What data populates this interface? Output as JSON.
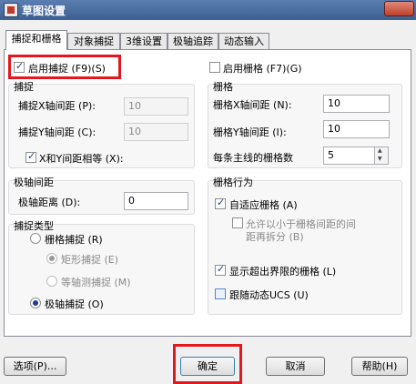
{
  "window": {
    "title": "草图设置"
  },
  "tabs": [
    {
      "label": "捕捉和栅格"
    },
    {
      "label": "对象捕捉"
    },
    {
      "label": "3维设置"
    },
    {
      "label": "极轴追踪"
    },
    {
      "label": "动态输入"
    }
  ],
  "snap": {
    "enable_label": "启用捕捉 (F9)(S)",
    "enabled": true,
    "group_title": "捕捉",
    "x_spacing_label": "捕捉X轴间距 (P):",
    "x_spacing_value": "10",
    "y_spacing_label": "捕捉Y轴间距 (C):",
    "y_spacing_value": "10",
    "equal_label": "X和Y间距相等 (X):",
    "equal_checked": true
  },
  "polar_spacing": {
    "group_title": "极轴间距",
    "distance_label": "极轴距离 (D):",
    "distance_value": "0"
  },
  "snap_type": {
    "group_title": "捕捉类型",
    "grid_snap_label": "栅格捕捉 (R)",
    "rect_snap_label": "矩形捕捉 (E)",
    "iso_snap_label": "等轴测捕捉 (M)",
    "polar_snap_label": "极轴捕捉 (O)"
  },
  "grid": {
    "enable_label": "启用栅格 (F7)(G)",
    "enabled": false,
    "group_title": "栅格",
    "x_spacing_label": "栅格X轴间距 (N):",
    "x_spacing_value": "10",
    "y_spacing_label": "栅格Y轴间距 (I):",
    "y_spacing_value": "10",
    "major_label": "每条主线的栅格数",
    "major_value": "5"
  },
  "grid_behavior": {
    "group_title": "栅格行为",
    "adaptive_label": "自适应栅格 (A)",
    "subdivide_label_1": "允许以小于栅格间距的间",
    "subdivide_label_2": "距再拆分 (B)",
    "beyond_limits_label": "显示超出界限的栅格 (L)",
    "follow_ucs_label": "跟随动态UCS (U)"
  },
  "buttons": {
    "options": "选项(P)...",
    "ok": "确定",
    "cancel": "取消",
    "help": "帮助(H)"
  },
  "colors": {
    "highlight": "#e3171e",
    "titlebar": "#4a6fa5"
  }
}
